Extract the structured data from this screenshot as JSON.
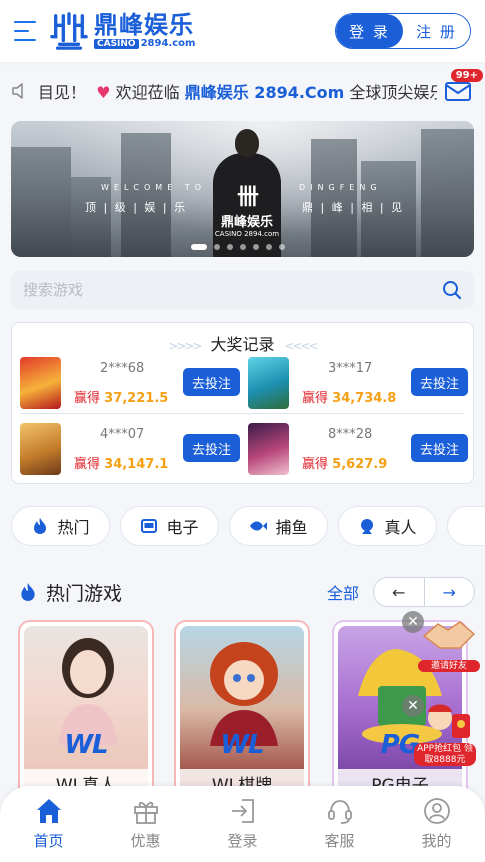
{
  "header": {
    "logo_name": "鼎峰娱乐",
    "logo_casino": "CASINO",
    "logo_domain": "2894.com",
    "login_label": "登 录",
    "register_label": "注 册"
  },
  "notice": {
    "prefix": "目见！",
    "text_before": "欢迎莅临",
    "highlight": "鼎峰娱乐 2894.Com",
    "text_after": "全球顶尖娱乐",
    "mail_badge": "99+"
  },
  "banner": {
    "welcome": "WELCOME TO",
    "dingfeng": "DINGFENG",
    "slogan_left": "顶 | 级 | 娱 | 乐",
    "slogan_right": "鼎 | 峰 | 相 | 见",
    "logo_name": "鼎峰娱乐",
    "logo_sub": "CASINO 2894.com",
    "dot_count": 7,
    "active_dot": 0
  },
  "search": {
    "placeholder": "搜索游戏"
  },
  "jackpot": {
    "title": "大奖记录",
    "win_label": "赢得",
    "button_label": "去投注",
    "entries": [
      {
        "user": "2***68",
        "amount": "37,221.5"
      },
      {
        "user": "3***17",
        "amount": "34,734.8"
      },
      {
        "user": "4***07",
        "amount": "34,147.1"
      },
      {
        "user": "8***28",
        "amount": "5,627.9"
      }
    ]
  },
  "categories": [
    {
      "label": "热门",
      "icon": "flame-icon"
    },
    {
      "label": "电子",
      "icon": "slot-machine-icon"
    },
    {
      "label": "捕鱼",
      "icon": "fish-icon"
    },
    {
      "label": "真人",
      "icon": "dealer-icon"
    },
    {
      "label": "",
      "icon": "cards-icon"
    }
  ],
  "hot_games": {
    "title": "热门游戏",
    "all_label": "全部",
    "prev": "←",
    "next": "→",
    "cards": [
      {
        "brand": "WL",
        "label": "WL真人"
      },
      {
        "brand": "WL",
        "label": "WL棋牌"
      },
      {
        "brand": "PG",
        "label": "PG电子"
      }
    ]
  },
  "promos": [
    {
      "tag": "邀请好友"
    },
    {
      "tag": "APP抢红包 领取8888元"
    }
  ],
  "tabbar": [
    {
      "label": "首页",
      "active": true
    },
    {
      "label": "优惠",
      "active": false
    },
    {
      "label": "登录",
      "active": false
    },
    {
      "label": "客服",
      "active": false
    },
    {
      "label": "我的",
      "active": false
    }
  ],
  "colors": {
    "primary": "#1a5ed8",
    "win_red": "#e0262d",
    "amount_orange": "#f5a015"
  }
}
